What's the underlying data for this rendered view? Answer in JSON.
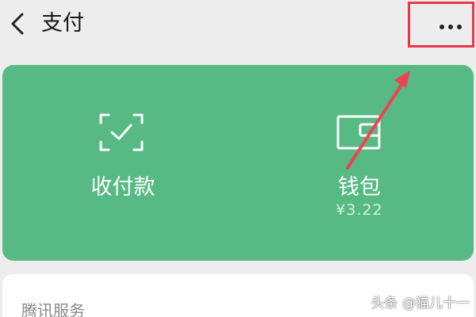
{
  "header": {
    "title": "支付",
    "back_icon": "chevron-left-icon",
    "more_icon": "ellipsis-icon",
    "highlight_color": "#e8384a"
  },
  "pay_card": {
    "background_color": "#57b983",
    "actions": [
      {
        "label": "收付款",
        "icon": "scan-check-icon"
      },
      {
        "label": "钱包",
        "icon": "wallet-card-icon",
        "balance": "¥3.22"
      }
    ]
  },
  "services": {
    "title": "腾讯服务"
  },
  "watermark": {
    "text": "头条 @猫儿十一"
  }
}
